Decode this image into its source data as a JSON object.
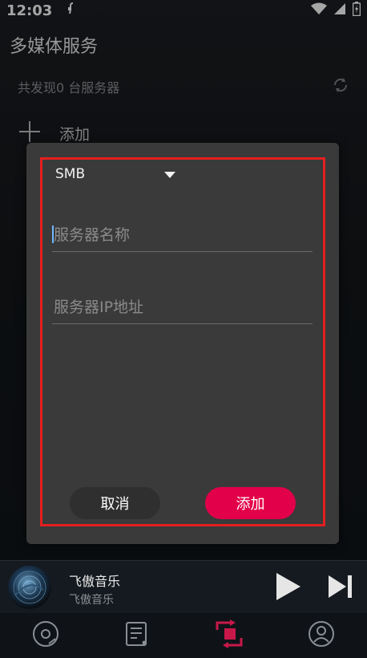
{
  "status_bar": {
    "time": "12:03",
    "icons": [
      "notification-f-icon",
      "wifi-icon",
      "signal-icon",
      "battery-icon"
    ]
  },
  "app_bar": {
    "title": "多媒体服务"
  },
  "server_list": {
    "count_text": "共发现0 台服务器",
    "add_label": "添加"
  },
  "dialog": {
    "type_selected": "SMB",
    "server_name_placeholder": "服务器名称",
    "server_ip_placeholder": "服务器IP地址",
    "cancel_label": "取消",
    "add_label": "添加"
  },
  "player": {
    "track_title": "飞傲音乐",
    "track_artist": "飞傲音乐"
  },
  "bottom_nav": {
    "items": [
      "music-disc-icon",
      "playlist-icon",
      "media-server-icon",
      "profile-icon"
    ],
    "active_index": 2
  },
  "colors": {
    "accent": "#e3004a",
    "highlight_border": "#e41f1f",
    "dialog_bg": "#3a3a3a"
  }
}
